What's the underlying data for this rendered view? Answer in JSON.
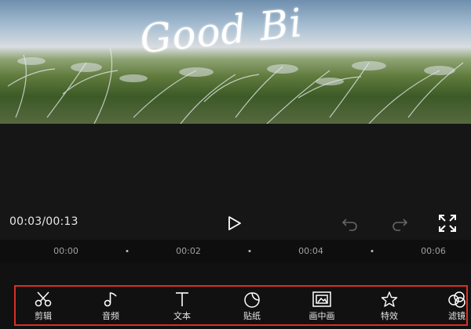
{
  "preview": {
    "overlay_text": "Good Bi"
  },
  "playback": {
    "time": "00:03/00:13",
    "icons": [
      "play-icon",
      "undo-icon",
      "redo-icon",
      "fullscreen-icon"
    ]
  },
  "timeline": {
    "ticks": [
      "00:00",
      "00:02",
      "00:04",
      "00:06"
    ]
  },
  "toolbar": {
    "highlight_color": "#d93025",
    "items": [
      {
        "label": "剪辑",
        "icon": "scissors-icon"
      },
      {
        "label": "音频",
        "icon": "music-note-icon"
      },
      {
        "label": "文本",
        "icon": "text-icon"
      },
      {
        "label": "贴纸",
        "icon": "sticker-icon"
      },
      {
        "label": "画中画",
        "icon": "picture-in-picture-icon"
      },
      {
        "label": "特效",
        "icon": "effects-star-icon"
      },
      {
        "label": "滤镜",
        "icon": "filter-icon"
      }
    ]
  }
}
